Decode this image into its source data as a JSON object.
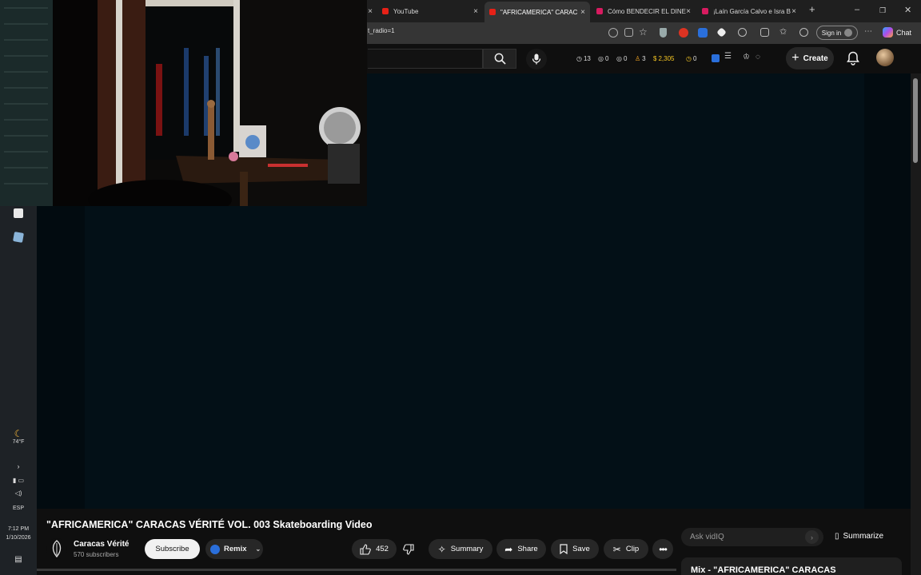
{
  "browser": {
    "tabs": [
      {
        "label": "YouTube",
        "active": false
      },
      {
        "label": "\"AFRICAMERICA\" CARAC",
        "active": true
      },
      {
        "label": "Cómo BENDECIR EL DINE",
        "active": false
      },
      {
        "label": "¡Laín García Calvo e Isra B",
        "active": false
      }
    ],
    "url": "t_radio=1",
    "sign_in_label": "Sign in",
    "chat_label": "Chat"
  },
  "header": {
    "stats": [
      "13",
      "0",
      "0",
      "3",
      "2,305",
      "0"
    ],
    "create_label": "Create"
  },
  "taskbar": {
    "weather": "74°F",
    "language": "ESP",
    "time": "7:12 PM",
    "date": "1/10/2026"
  },
  "video": {
    "title": "\"AFRICAMERICA\" CARACAS VÉRITÉ VOL. 003 Skateboarding Video",
    "channel_name": "Caracas Vérité",
    "subscribers": "570 subscribers",
    "subscribe_label": "Subscribe",
    "remix_label": "Remix",
    "like_count": "452",
    "summary_label": "Summary",
    "share_label": "Share",
    "save_label": "Save",
    "clip_label": "Clip"
  },
  "sidebar": {
    "ask_placeholder": "Ask vidIQ",
    "summarize_label": "Summarize",
    "mix_title": "Mix - \"AFRICAMERICA\" CARACAS"
  }
}
